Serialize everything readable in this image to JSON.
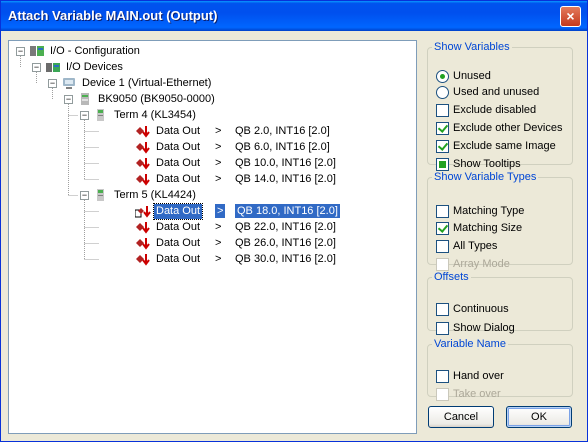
{
  "window": {
    "title": "Attach Variable MAIN.out (Output)",
    "close_label": "×"
  },
  "tree": {
    "nodes": {
      "io_config": "I/O - Configuration",
      "io_devices": "I/O Devices",
      "device1": "Device 1 (Virtual-Ethernet)",
      "bk9050": "BK9050 (BK9050-0000)",
      "term4": "Term 4 (KL3454)",
      "term5": "Term 5 (KL4424)"
    },
    "term4_vars": [
      {
        "name": "Data Out",
        "arrow": ">",
        "info": "QB 2.0, INT16 [2.0]"
      },
      {
        "name": "Data Out",
        "arrow": ">",
        "info": "QB 6.0, INT16 [2.0]"
      },
      {
        "name": "Data Out",
        "arrow": ">",
        "info": "QB 10.0, INT16 [2.0]"
      },
      {
        "name": "Data Out",
        "arrow": ">",
        "info": "QB 14.0, INT16 [2.0]"
      }
    ],
    "term5_vars": [
      {
        "name": "Data Out",
        "arrow": ">",
        "info": "QB 18.0, INT16 [2.0]",
        "selected": true
      },
      {
        "name": "Data Out",
        "arrow": ">",
        "info": "QB 22.0, INT16 [2.0]"
      },
      {
        "name": "Data Out",
        "arrow": ">",
        "info": "QB 26.0, INT16 [2.0]"
      },
      {
        "name": "Data Out",
        "arrow": ">",
        "info": "QB 30.0, INT16 [2.0]"
      }
    ]
  },
  "show_variables": {
    "legend": "Show Variables",
    "unused": "Unused",
    "used_and_unused": "Used and unused",
    "exclude_disabled": "Exclude disabled",
    "exclude_other_devices": "Exclude other Devices",
    "exclude_same_image": "Exclude same Image",
    "show_tooltips": "Show Tooltips"
  },
  "show_variable_types": {
    "legend": "Show Variable Types",
    "matching_type": "Matching Type",
    "matching_size": "Matching Size",
    "all_types": "All Types",
    "array_mode": "Array Mode"
  },
  "offsets": {
    "legend": "Offsets",
    "continuous": "Continuous",
    "show_dialog": "Show Dialog"
  },
  "variable_name": {
    "legend": "Variable Name",
    "hand_over": "Hand over",
    "take_over": "Take over"
  },
  "buttons": {
    "cancel": "Cancel",
    "ok": "OK"
  },
  "colors": {
    "title_bar": "#0053ee",
    "selection": "#316ac5",
    "group_legend": "#0046d5",
    "check": "#21a121"
  },
  "icons": {
    "var_icon": "output-variable-icon",
    "config_icon": "io-config-icon",
    "device_icon": "network-device-icon",
    "terminal_icon": "terminal-icon"
  }
}
